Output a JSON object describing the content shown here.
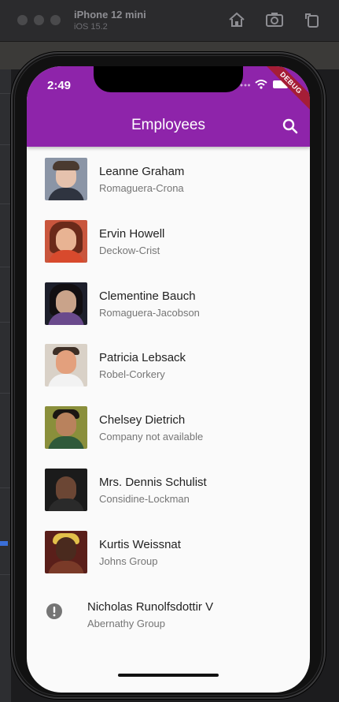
{
  "simulator": {
    "device_name": "iPhone 12 mini",
    "os_version": "iOS 15.2",
    "tools": [
      "home-icon",
      "screenshot-icon",
      "rotate-icon"
    ]
  },
  "status_bar": {
    "time": "2:49"
  },
  "debug_banner": "DEBUG",
  "app_bar": {
    "title": "Employees",
    "action_icon": "search-icon"
  },
  "colors": {
    "app_bar": "#8e24aa",
    "background": "#fafafa",
    "debug_ribbon": "#a51d36"
  },
  "employees": [
    {
      "name": "Leanne Graham",
      "company": "Romaguera-Crona",
      "has_avatar": true
    },
    {
      "name": "Ervin Howell",
      "company": "Deckow-Crist",
      "has_avatar": true
    },
    {
      "name": "Clementine Bauch",
      "company": "Romaguera-Jacobson",
      "has_avatar": true
    },
    {
      "name": "Patricia Lebsack",
      "company": "Robel-Corkery",
      "has_avatar": true
    },
    {
      "name": "Chelsey Dietrich",
      "company": "Company not available",
      "has_avatar": true
    },
    {
      "name": "Mrs. Dennis Schulist",
      "company": "Considine-Lockman",
      "has_avatar": true
    },
    {
      "name": "Kurtis Weissnat",
      "company": "Johns Group",
      "has_avatar": true
    },
    {
      "name": "Nicholas Runolfsdottir V",
      "company": "Abernathy Group",
      "has_avatar": false,
      "icon": "error-icon"
    }
  ]
}
